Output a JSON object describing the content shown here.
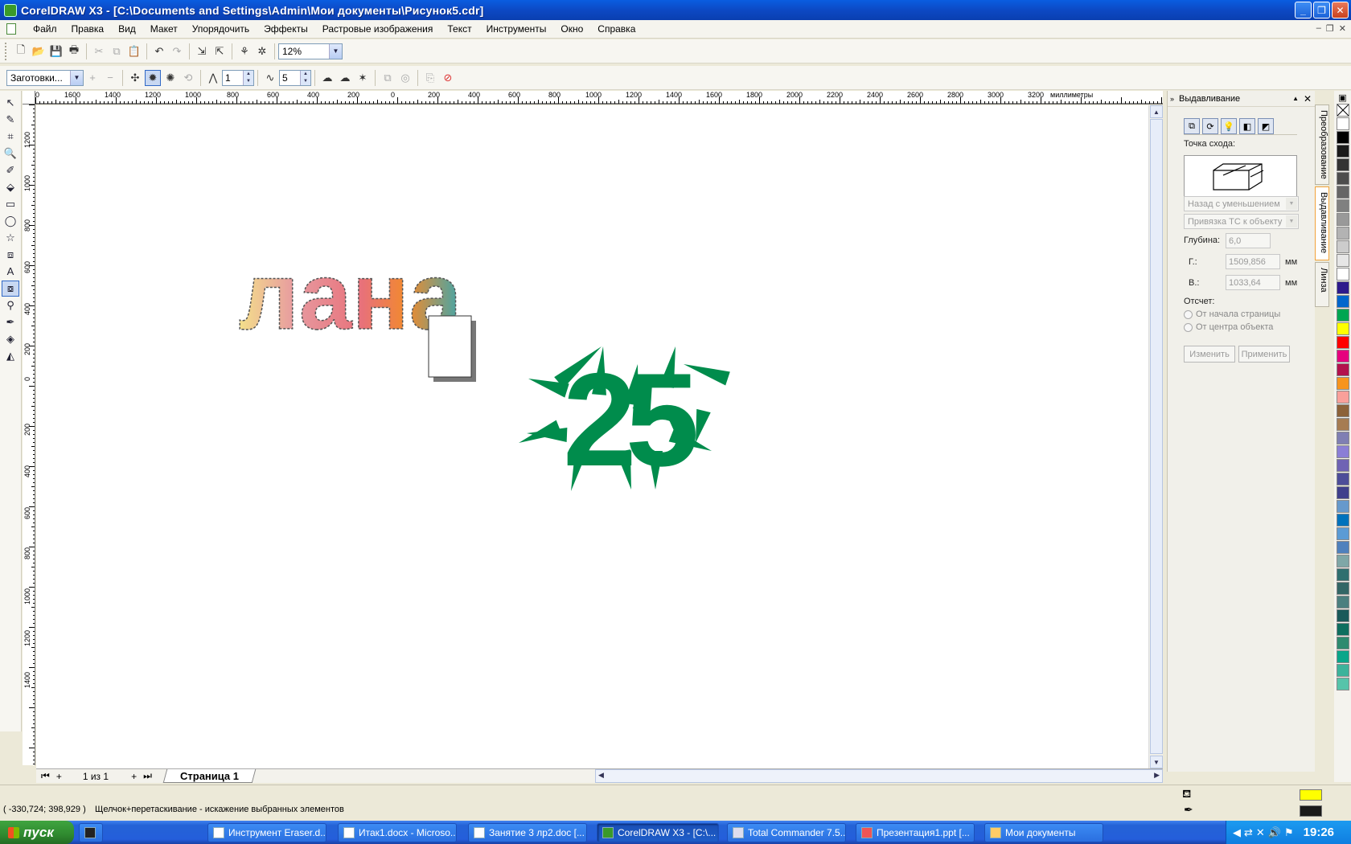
{
  "window": {
    "title": "CorelDRAW X3 - [C:\\Documents and Settings\\Admin\\Мои документы\\Рисунок5.cdr]"
  },
  "menu": [
    "Файл",
    "Правка",
    "Вид",
    "Макет",
    "Упорядочить",
    "Эффекты",
    "Растровые изображения",
    "Текст",
    "Инструменты",
    "Окно",
    "Справка"
  ],
  "toolbar": {
    "zoom": "12%"
  },
  "property_bar": {
    "presets": "Заготовки...",
    "value1": "1",
    "value2": "5"
  },
  "ruler": {
    "unit": "миллиметры",
    "top_ticks": [
      "1600",
      "1400",
      "1200",
      "1000",
      "800",
      "600",
      "400",
      "200",
      "0",
      "200",
      "400",
      "600",
      "800",
      "1000",
      "1200",
      "1400",
      "1600",
      "1800",
      "2000",
      "2200",
      "2400",
      "2600",
      "2800",
      "3000",
      "3200"
    ],
    "left_ticks": [
      "1200",
      "1000",
      "800",
      "600",
      "400",
      "200",
      "0",
      "200",
      "400",
      "600",
      "800",
      "1000",
      "1200",
      "1400"
    ]
  },
  "canvas": {
    "text1": "лана",
    "text2": "25",
    "text2_color": "#008c4c"
  },
  "page_nav": {
    "counter": "1 из 1",
    "page_tab": "Страница 1"
  },
  "status": {
    "coords": "( -330,724; 398,929 )",
    "hint": "Щелчок+перетаскивание - искажение выбранных элементов",
    "fill_color": "#ffff00",
    "outline_color": "#1a1a1a"
  },
  "docker": {
    "title": "Выдавливание",
    "vanishing_label": "Точка схода:",
    "combo1": "Назад с уменьшением",
    "combo2": "Привязка ТС к объекту",
    "depth_label": "Глубина:",
    "depth_value": "6,0",
    "h_label": "Г.:",
    "h_value": "1509,856",
    "v_label": "В.:",
    "v_value": "1033,64",
    "unit": "мм",
    "origin_label": "Отсчет:",
    "radio1": "От начала страницы",
    "radio2": "От центра объекта",
    "edit_button": "Изменить",
    "apply_button": "Применить"
  },
  "vertical_tabs": [
    "Преобразование",
    "Выдавливание",
    "Линза"
  ],
  "palette": [
    "#ffffff",
    "#000000",
    "#1a1a1a",
    "#333333",
    "#4d4d4d",
    "#666666",
    "#808080",
    "#999999",
    "#b3b3b3",
    "#cccccc",
    "#e6e6e6",
    "#ffffff",
    "#2e1a8c",
    "#0066cc",
    "#00a651",
    "#ffff00",
    "#ff0000",
    "#e6007e",
    "#b3124d",
    "#f7941d",
    "#f9a09a",
    "#8c6239",
    "#a67c52",
    "#7f7fb3",
    "#8b7fd6",
    "#6f63b4",
    "#4d4d99",
    "#3f3f8c",
    "#6699cc",
    "#0072bc",
    "#5b9bd5",
    "#4f81bd",
    "#7fa7a7",
    "#2f6f6f",
    "#336666",
    "#4c7f7f",
    "#1a5a5a",
    "#0f6f5f",
    "#2e8b6f",
    "#0aa68a",
    "#3cb39b",
    "#56c4aa"
  ],
  "taskbar": {
    "start": "пуск",
    "tasks": [
      "Инструмент Eraser.d...",
      "Итак1.docx - Microso...",
      "Занятие 3 лр2.doc [...",
      "CorelDRAW X3 - [C:\\...",
      "Total Commander 7.5...",
      "Презентация1.ppt [...",
      "Мои документы"
    ],
    "clock": "19:26"
  }
}
